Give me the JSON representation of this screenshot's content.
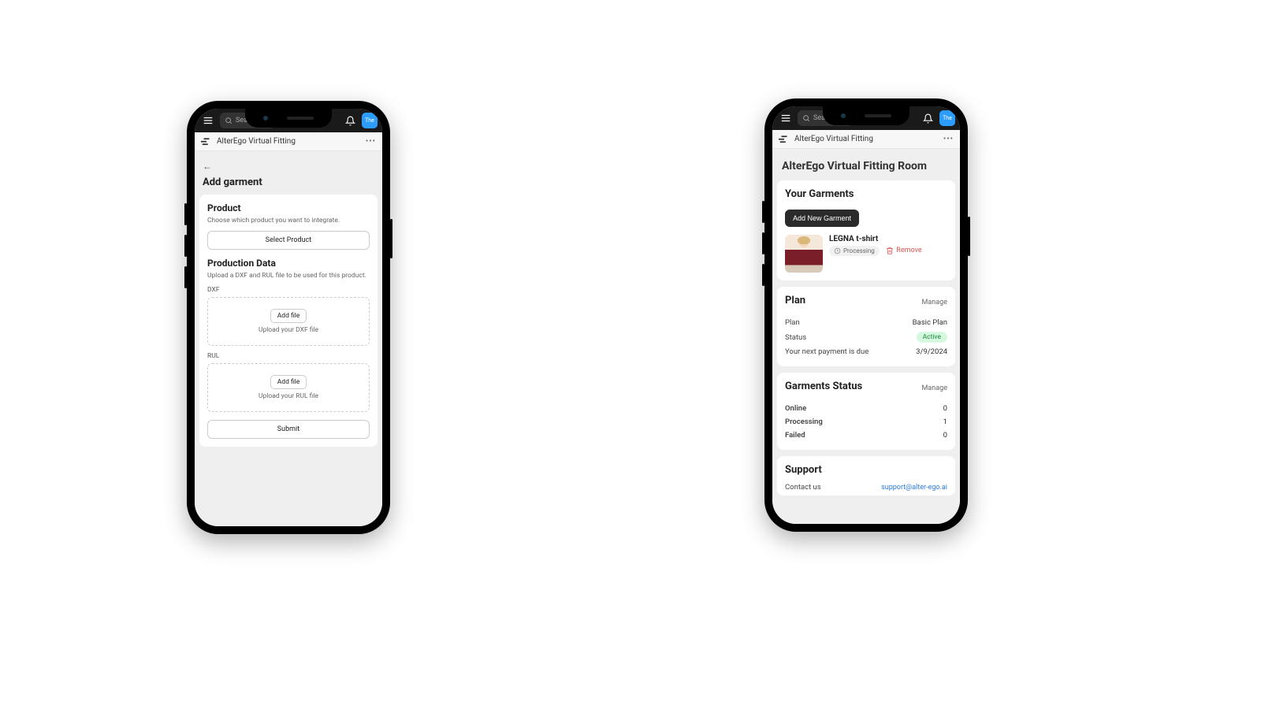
{
  "topbar": {
    "search_placeholder": "Search",
    "avatar_text": "The"
  },
  "appheader": {
    "title": "AlterEgo Virtual Fitting"
  },
  "left": {
    "page_title": "Add garment",
    "product": {
      "heading": "Product",
      "sub": "Choose which product you want to integrate.",
      "select_btn": "Select Product"
    },
    "production": {
      "heading": "Production Data",
      "sub": "Upload a DXF and RUL file to be used for this product.",
      "dxf_label": "DXF",
      "dxf_addfile": "Add file",
      "dxf_hint": "Upload your DXF file",
      "rul_label": "RUL",
      "rul_addfile": "Add file",
      "rul_hint": "Upload your RUL file"
    },
    "submit": "Submit"
  },
  "right": {
    "page_title": "AlterEgo Virtual Fitting Room",
    "garments": {
      "heading": "Your Garments",
      "add_btn": "Add New Garment",
      "item": {
        "name": "LEGNA t-shirt",
        "status": "Processing",
        "remove": "Remove"
      }
    },
    "plan": {
      "heading": "Plan",
      "manage": "Manage",
      "rows": {
        "plan_label": "Plan",
        "plan_value": "Basic Plan",
        "status_label": "Status",
        "status_value": "Active",
        "next_label": "Your next payment is due",
        "next_value": "3/9/2024"
      }
    },
    "status": {
      "heading": "Garments Status",
      "manage": "Manage",
      "online_label": "Online",
      "online_value": "0",
      "proc_label": "Processing",
      "proc_value": "1",
      "failed_label": "Failed",
      "failed_value": "0"
    },
    "support": {
      "heading": "Support",
      "contact_label": "Contact us",
      "email": "support@alter-ego.ai"
    }
  }
}
